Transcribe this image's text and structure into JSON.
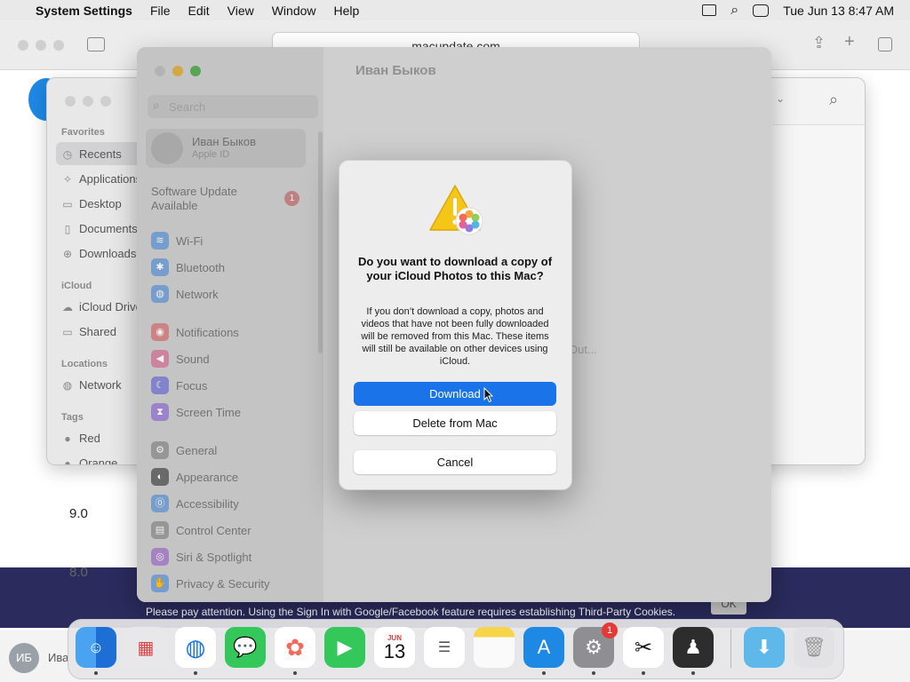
{
  "menubar": {
    "app_name": "System Settings",
    "menus": [
      "File",
      "Edit",
      "View",
      "Window",
      "Help"
    ],
    "clock": "Tue Jun 13  8:47 AM"
  },
  "safari": {
    "address": "macupdate.com",
    "notice": "Please pay attention. Using the Sign In with Google/Facebook feature requires establishing Third-Party Cookies.",
    "ok_label": "OK",
    "version_a": "9.0",
    "version_b": "8.0",
    "avatar_initials": "ИБ",
    "name_fragment": "Ива"
  },
  "finder": {
    "favorites_header": "Favorites",
    "favorites": [
      "Recents",
      "Applications",
      "Desktop",
      "Documents",
      "Downloads"
    ],
    "icloud_header": "iCloud",
    "icloud": [
      "iCloud Drive",
      "Shared"
    ],
    "locations_header": "Locations",
    "locations": [
      "Network"
    ],
    "tags_header": "Tags",
    "tags": [
      "Red",
      "Orange"
    ]
  },
  "settings": {
    "title": "Иван Быков",
    "search_placeholder": "Search",
    "user_name": "Иван Быков",
    "user_sub": "Apple ID",
    "update_line1": "Software Update",
    "update_line2": "Available",
    "update_badge": "1",
    "items": [
      {
        "label": "Wi-Fi",
        "color": "#7fa7d9"
      },
      {
        "label": "Bluetooth",
        "color": "#7fa7d9"
      },
      {
        "label": "Network",
        "color": "#7fa7d9"
      },
      {
        "label": "Notifications",
        "color": "#d98c8c"
      },
      {
        "label": "Sound",
        "color": "#d98ca8"
      },
      {
        "label": "Focus",
        "color": "#8c8cd9"
      },
      {
        "label": "Screen Time",
        "color": "#a58cd9"
      },
      {
        "label": "General",
        "color": "#a0a0a0"
      },
      {
        "label": "Appearance",
        "color": "#707070"
      },
      {
        "label": "Accessibility",
        "color": "#7fa7d9"
      },
      {
        "label": "Control Center",
        "color": "#a0a0a0"
      },
      {
        "label": "Siri & Spotlight",
        "color": "#b08cd0"
      },
      {
        "label": "Privacy & Security",
        "color": "#7fa7d9"
      }
    ],
    "right_fragment": "Out..."
  },
  "dialog": {
    "title": "Do you want to download a copy of your iCloud Photos to this Mac?",
    "message": "If you don’t download a copy, photos and videos that have not been fully downloaded will be removed from this Mac. These items will still be available on other devices using iCloud.",
    "download": "Download",
    "delete": "Delete from Mac",
    "cancel": "Cancel"
  },
  "dock": {
    "calendar_month": "JUN",
    "calendar_day": "13",
    "settings_badge": "1",
    "apps": [
      "finder",
      "launchpad",
      "safari",
      "messages",
      "photos",
      "facetime",
      "calendar",
      "reminders",
      "notes",
      "app-store",
      "system-settings",
      "capcut",
      "bartender",
      "downloads",
      "trash"
    ]
  }
}
